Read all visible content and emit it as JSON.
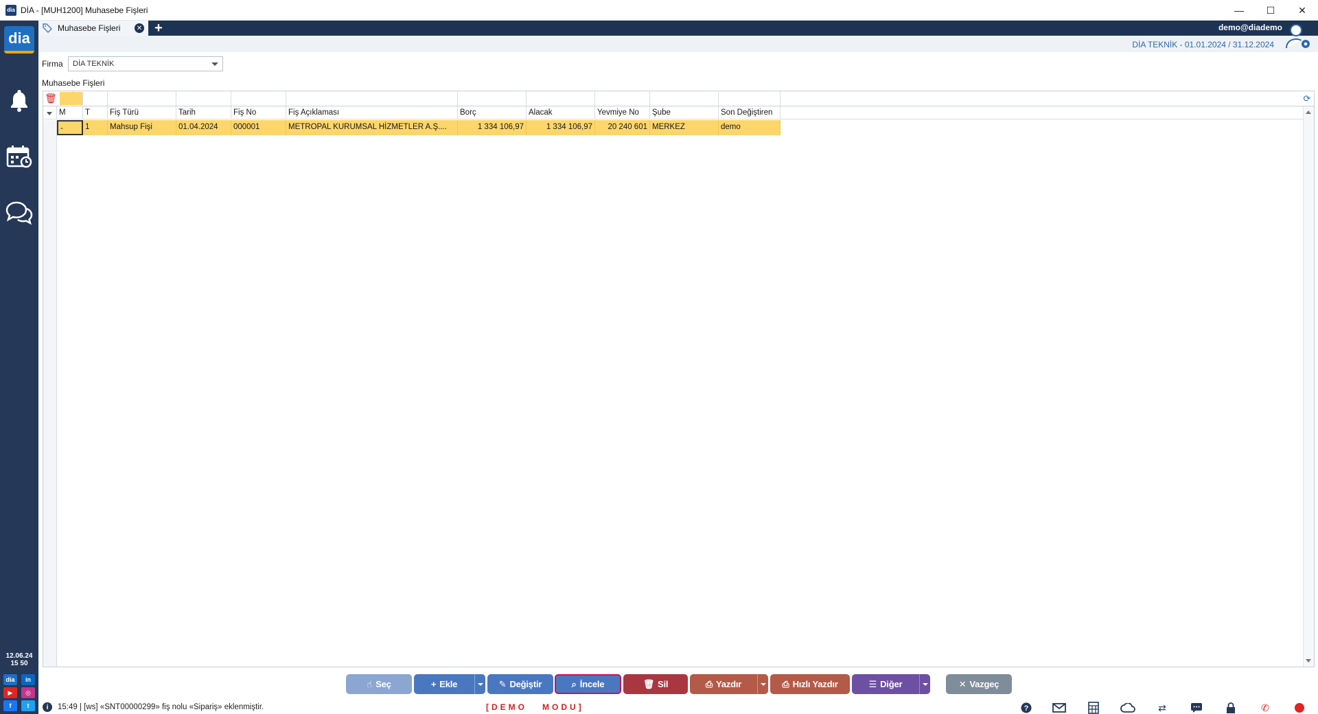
{
  "window": {
    "title": "DİA - [MUH1200] Muhasebe Fişleri",
    "controls": [
      "—",
      "☐",
      "✕"
    ]
  },
  "sidebar": {
    "logo": "dia",
    "date": "12.06.24",
    "time": "15 50",
    "social": [
      "dia",
      "in",
      "▶",
      "◎",
      "f",
      "t"
    ]
  },
  "tabs": [
    {
      "label": "Muhasebe Fişleri"
    }
  ],
  "header": {
    "user": "demo@diademo",
    "period": "DİA TEKNİK -  01.01.2024 / 31.12.2024"
  },
  "filter": {
    "firma_label": "Firma",
    "firma_value": "DİA TEKNİK"
  },
  "section_title": "Muhasebe Fişleri",
  "table": {
    "columns": [
      "M",
      "T",
      "Fiş Türü",
      "Tarih",
      "Fiş No",
      "Fiş Açıklaması",
      "Borç",
      "Alacak",
      "Yevmiye No",
      "Şube",
      "Son Değiştiren"
    ],
    "rows": [
      [
        "-",
        "1",
        "Mahsup Fişi",
        "01.04.2024",
        "000001",
        "METROPAL KURUMSAL HİZMETLER A.Ş....",
        "1 334 106,97",
        "1 334 106,97",
        "20 240 601",
        "MERKEZ",
        "demo"
      ]
    ]
  },
  "buttons": {
    "sec": "Seç",
    "ekle": "Ekle",
    "degistir": "Değiştir",
    "incele": "İncele",
    "sil": "Sil",
    "yazdir": "Yazdır",
    "hizli_yazdir": "Hızlı Yazdır",
    "diger": "Diğer",
    "vazgec": "Vazgeç"
  },
  "colors": {
    "sidebar": "#253858",
    "row_highlight": "#fcd66a",
    "btn_blue": "#4a78c0",
    "btn_red": "#a8373f",
    "btn_brown": "#b45a48",
    "btn_purple": "#6d4fa3",
    "btn_gray": "#7f8c99"
  },
  "status": {
    "message": "15:49  |  [ws] «SNT00000299» fiş nolu «Sipariş» eklenmiştir.",
    "demo": "[DEMO   MODU]"
  }
}
